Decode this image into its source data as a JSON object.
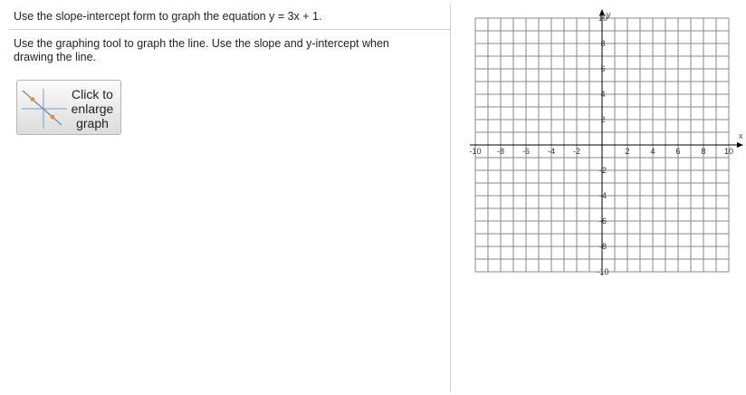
{
  "question": {
    "text": "Use the slope-intercept form to graph the equation y = 3x + 1."
  },
  "instructions": {
    "text": "Use the graphing tool to graph the line.  Use the slope and y-intercept when drawing the line."
  },
  "enlarge_button": {
    "label_line1": "Click to",
    "label_line2": "enlarge",
    "label_line3": "graph",
    "icon": "graph-line-icon"
  },
  "graph": {
    "x_axis_label": "x",
    "y_axis_label": "y",
    "x_range": [
      -10,
      10
    ],
    "y_range": [
      -10,
      10
    ],
    "grid_step": 1,
    "x_tick_labels": [
      "-10",
      "-8",
      "-6",
      "-4",
      "-2",
      "2",
      "4",
      "6",
      "8",
      "10"
    ],
    "y_tick_labels": [
      "10",
      "8",
      "6",
      "4",
      "2",
      "-2",
      "-4",
      "-6",
      "-8",
      "-10"
    ],
    "grid_color": "#8a8a8a",
    "axis_color": "#000000"
  }
}
